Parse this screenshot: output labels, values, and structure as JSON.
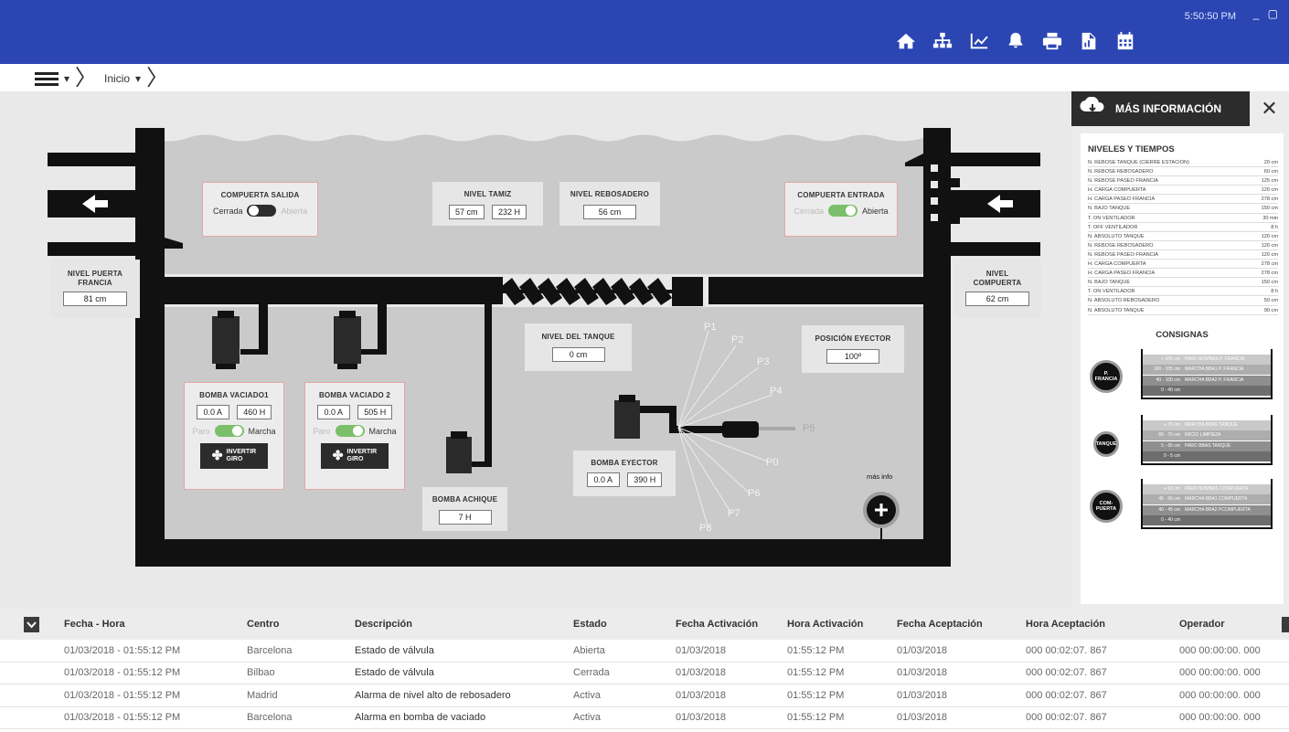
{
  "window": {
    "clock": "5:50:50 PM",
    "minimize": "_",
    "maximize": "▢"
  },
  "nav": {
    "icons": [
      "home-icon",
      "sitemap-icon",
      "chart-icon",
      "bell-icon",
      "print-icon",
      "report-icon",
      "calendar-icon"
    ]
  },
  "breadcrumb": {
    "item": "Inicio"
  },
  "scene": {
    "compuerta_salida": {
      "title": "COMPUERTA SALIDA",
      "off_label": "Cerrada",
      "on_label": "Abierta",
      "state": "off"
    },
    "nivel_tamiz": {
      "title": "NIVEL TAMIZ",
      "v1": "57 cm",
      "v2": "232 H"
    },
    "nivel_rebosadero": {
      "title": "NIVEL REBOSADERO",
      "v1": "56 cm"
    },
    "compuerta_entrada": {
      "title": "COMPUERTA ENTRADA",
      "off_label": "Cerrada",
      "on_label": "Abierta",
      "state": "on"
    },
    "nivel_puerta": {
      "title1": "NIVEL PUERTA",
      "title2": "FRANCIA",
      "v1": "81 cm"
    },
    "nivel_compuerta": {
      "title1": "NIVEL",
      "title2": "COMPUERTA",
      "v1": "62 cm"
    },
    "nivel_tanque": {
      "title": "NIVEL DEL TANQUE",
      "v1": "0 cm"
    },
    "posicion_eyector": {
      "title": "POSICIÓN EYECTOR",
      "v1": "100º"
    },
    "bomba1": {
      "title": "BOMBA VACIADO1",
      "v1": "0.0 A",
      "v2": "460 H",
      "off_label": "Paro",
      "on_label": "Marcha",
      "btn1": "INVERTIR",
      "btn2": "GIRO"
    },
    "bomba2": {
      "title": "BOMBA VACIADO 2",
      "v1": "0.0 A",
      "v2": "505 H",
      "off_label": "Paro",
      "on_label": "Marcha",
      "btn1": "INVERTIR",
      "btn2": "GIRO"
    },
    "bomba_achique": {
      "title": "BOMBA ACHIQUE",
      "v1": "7 H"
    },
    "bomba_eyector": {
      "title": "BOMBA EYECTOR",
      "v1": "0.0 A",
      "v2": "390 H"
    },
    "positions": [
      "P1",
      "P2",
      "P3",
      "P4",
      "P5",
      "P0",
      "P6",
      "P7",
      "P8"
    ],
    "mas_info": "más info"
  },
  "info": {
    "title": "MÁS INFORMACIÓN",
    "close": "✕",
    "niveles_title": "NIVELES Y TIEMPOS",
    "niveles": [
      [
        "N. REBOSE TANQUE (CIERRE ESTACION)",
        "20 cm"
      ],
      [
        "N. REBOSE REBOSADERO",
        "60 cm"
      ],
      [
        "N. REBOSE PASEO FRANCIA",
        "125 cm"
      ],
      [
        "H. CARGA COMPUERTA",
        "120 cm"
      ],
      [
        "H. CARGA PASEO FRANCIA",
        "278 cm"
      ],
      [
        "N. BAJO TANQUE",
        "150 cm"
      ],
      [
        "T. ON VENTILADOR",
        "30 min"
      ],
      [
        "T. OFF VENTILADOR",
        "8 h"
      ],
      [
        "N. ABSOLUTO TANQUE",
        "120 cm"
      ],
      [
        "N. REBOSE REBOSADERO",
        "120 cm"
      ],
      [
        "N. REBOSE PASEO FRANCIA",
        "120 cm"
      ],
      [
        "H. CARGA COMPUERTA",
        "278 cm"
      ],
      [
        "H. CARGA PASEO FRANCIA",
        "278 cm"
      ],
      [
        "N. BAJO TANQUE",
        "150 cm"
      ],
      [
        "T. ON VENTILADOR",
        "8 h"
      ],
      [
        "N. ABSOLUTO REBOSADERO",
        "50 cm"
      ],
      [
        "N. ABSOLUTO TANQUE",
        "90 cm"
      ]
    ],
    "consignas_title": "CONSIGNAS",
    "consignas": [
      {
        "label1": "P.",
        "label2": "FRANCIA",
        "rows": [
          [
            "+ 105 cm",
            "PARO BOMBAS P. FRANCIA"
          ],
          [
            "100 - 105 cm",
            "MARCHA BBA1 P. FRANCIA"
          ],
          [
            "40 - 100 cm",
            "MARCHA BBA2 P. FRANCIA"
          ],
          [
            "0 - 40 cm",
            ""
          ]
        ]
      },
      {
        "label1": "TANQUE",
        "label2": "",
        "rows": [
          [
            "+ 70 cm",
            "MARCHA BBAS TANQUE"
          ],
          [
            "65 - 70 cm",
            "INICIO LIMPIEZA"
          ],
          [
            "5 - 65 cm",
            "PARO BBAS TANQUE"
          ],
          [
            "0 - 5 cm",
            ""
          ]
        ]
      },
      {
        "label1": "COM-",
        "label2": "PUERTA",
        "rows": [
          [
            "+ 63 cm",
            "PARO BOMBAS COMPUERTA"
          ],
          [
            "45 - 50 cm",
            "MARCHA BBA1 COMPUERTA"
          ],
          [
            "40 - 45 cm",
            "MARCHA BBA2 PCOMPUERTA"
          ],
          [
            "0 - 40 cm",
            ""
          ]
        ]
      }
    ]
  },
  "table": {
    "headers": [
      "Fecha - Hora",
      "Centro",
      "Descripción",
      "Estado",
      "Fecha Activación",
      "Hora Activación",
      "Fecha Aceptación",
      "Hora Aceptación",
      "Operador"
    ],
    "rows": [
      [
        "01/03/2018 - 01:55:12 PM",
        "Barcelona",
        "Estado de válvula",
        "Abierta",
        "01/03/2018",
        "01:55:12 PM",
        "01/03/2018",
        "000 00:02:07. 867",
        "000 00:00:00. 000"
      ],
      [
        "01/03/2018 - 01:55:12 PM",
        "Bilbao",
        "Estado de válvula",
        "Cerrada",
        "01/03/2018",
        "01:55:12 PM",
        "01/03/2018",
        "000 00:02:07. 867",
        "000 00:00:00. 000"
      ],
      [
        "01/03/2018 - 01:55:12 PM",
        "Madrid",
        "Alarma de nivel alto de rebosadero",
        "Activa",
        "01/03/2018",
        "01:55:12 PM",
        "01/03/2018",
        "000 00:02:07. 867",
        "000 00:00:00. 000"
      ],
      [
        "01/03/2018 - 01:55:12 PM",
        "Barcelona",
        "Alarma en bomba de vaciado",
        "Activa",
        "01/03/2018",
        "01:55:12 PM",
        "01/03/2018",
        "000 00:02:07. 867",
        "000 00:00:00. 000"
      ]
    ]
  },
  "colors": {
    "topbar": "#2b45b3",
    "pipe": "#111111",
    "water": "#cacaca",
    "toggle_on": "#7bbf6a",
    "panel_border": "#e5a6a6"
  }
}
